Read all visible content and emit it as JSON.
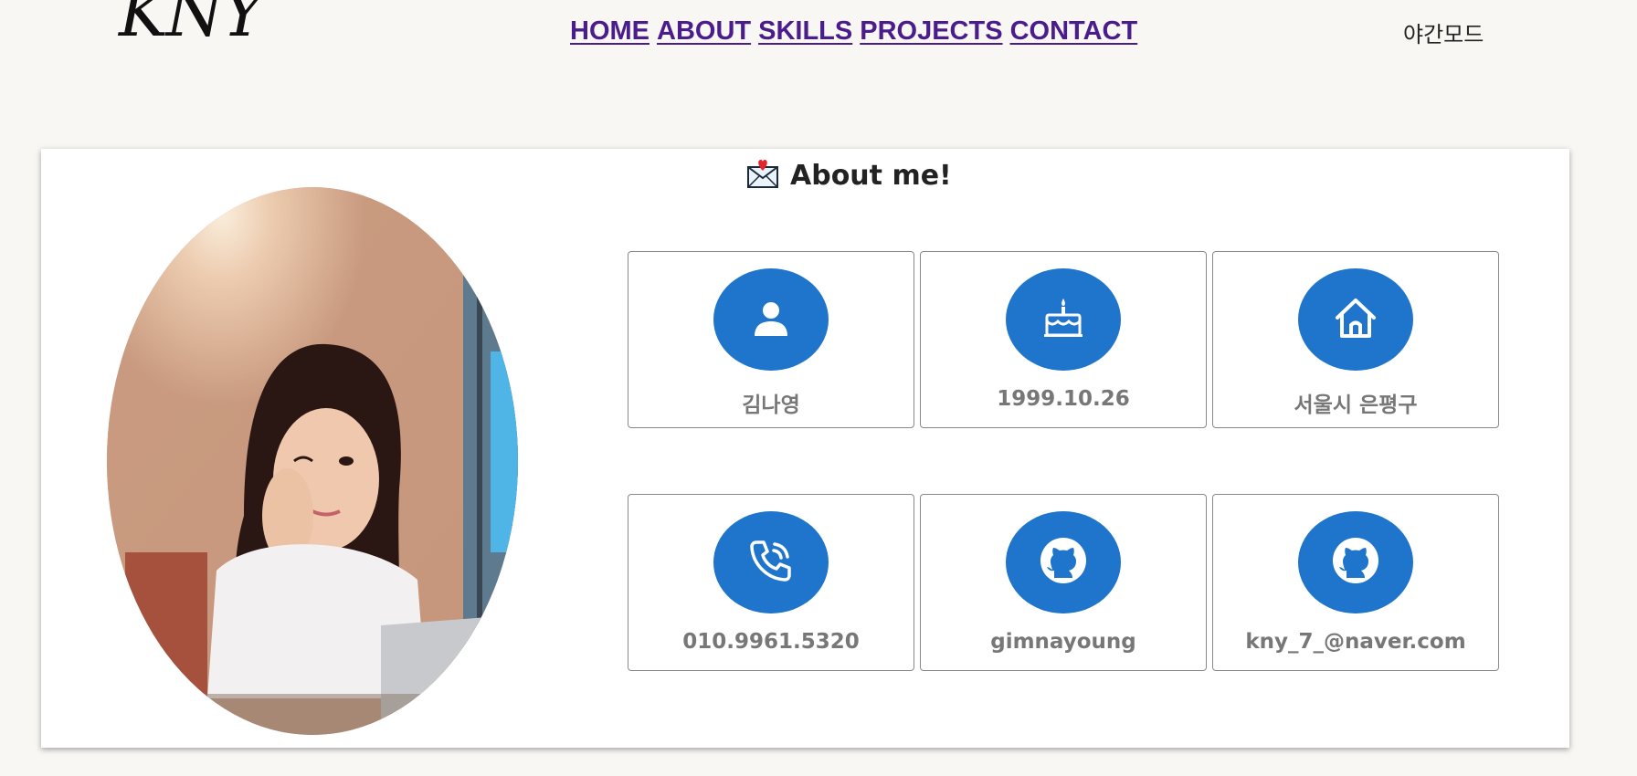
{
  "header": {
    "logo_text": "KNY",
    "nav": [
      {
        "label": "HOME"
      },
      {
        "label": "ABOUT"
      },
      {
        "label": "SKILLS"
      },
      {
        "label": "PROJECTS"
      },
      {
        "label": "CONTACT"
      }
    ],
    "night_mode_label": "야간모드"
  },
  "about": {
    "title": "About me!",
    "title_icon": "love-letter-icon",
    "photo_icon": "profile-photo",
    "items": [
      {
        "icon": "person-icon",
        "label": "김나영"
      },
      {
        "icon": "birthday-cake-icon",
        "label": "1999.10.26"
      },
      {
        "icon": "house-icon",
        "label": "서울시 은평구"
      },
      {
        "icon": "phone-icon",
        "label": "010.9961.5320"
      },
      {
        "icon": "github-icon",
        "label": "gimnayoung"
      },
      {
        "icon": "github-icon",
        "label": "kny_7_@naver.com"
      }
    ]
  },
  "colors": {
    "accent_blue": "#1f75cb",
    "nav_purple": "#4a1c8c",
    "background": "#f8f7f4",
    "label_gray": "#777777"
  }
}
